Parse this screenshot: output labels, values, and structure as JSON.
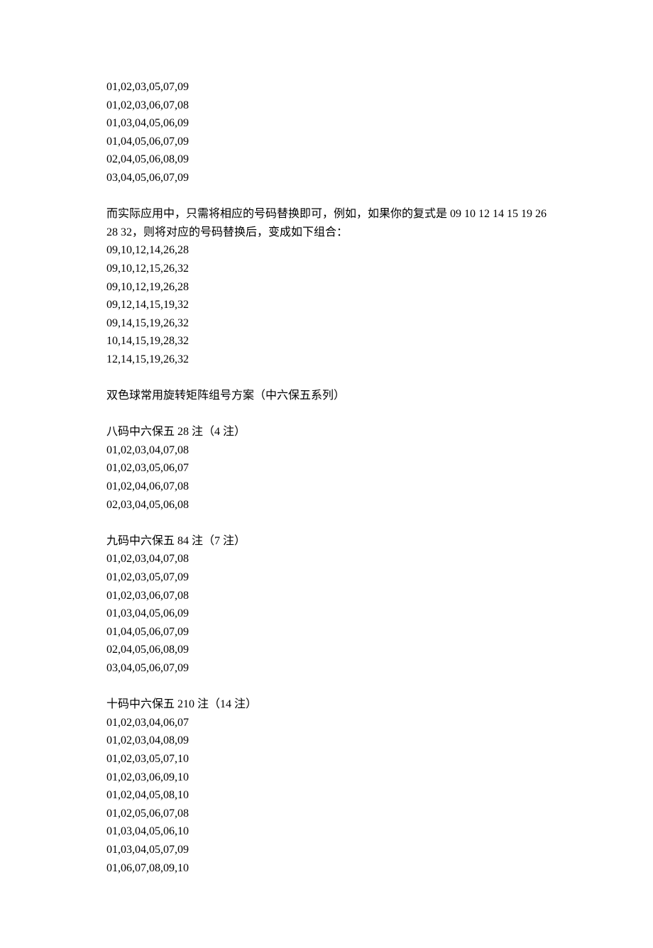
{
  "block1": [
    "01,02,03,05,07,09",
    "01,02,03,06,07,08",
    "01,03,04,05,06,09",
    "01,04,05,06,07,09",
    "02,04,05,06,08,09",
    "03,04,05,06,07,09"
  ],
  "para1": "而实际应用中，只需将相应的号码替换即可，例如，如果你的复式是 09 10 12 14 15 19 26 28 32，则将对应的号码替换后，变成如下组合：",
  "block2": [
    "09,10,12,14,26,28",
    "09,10,12,15,26,32",
    "09,10,12,19,26,28",
    "09,12,14,15,19,32",
    "09,14,15,19,26,32",
    "10,14,15,19,28,32",
    "12,14,15,19,26,32"
  ],
  "heading1": "双色球常用旋转矩阵组号方案（中六保五系列）",
  "section1_title": "八码中六保五 28 注（4 注）",
  "section1_lines": [
    "01,02,03,04,07,08",
    "01,02,03,05,06,07",
    "01,02,04,06,07,08",
    "02,03,04,05,06,08"
  ],
  "section2_title": "九码中六保五 84 注（7 注）",
  "section2_lines": [
    "01,02,03,04,07,08",
    "01,02,03,05,07,09",
    "01,02,03,06,07,08",
    "01,03,04,05,06,09",
    "01,04,05,06,07,09",
    "02,04,05,06,08,09",
    "03,04,05,06,07,09"
  ],
  "section3_title": "十码中六保五 210 注（14 注）",
  "section3_lines": [
    "01,02,03,04,06,07",
    "01,02,03,04,08,09",
    "01,02,03,05,07,10",
    "01,02,03,06,09,10",
    "01,02,04,05,08,10",
    "01,02,05,06,07,08",
    "01,03,04,05,06,10",
    "01,03,04,05,07,09",
    "01,06,07,08,09,10"
  ]
}
